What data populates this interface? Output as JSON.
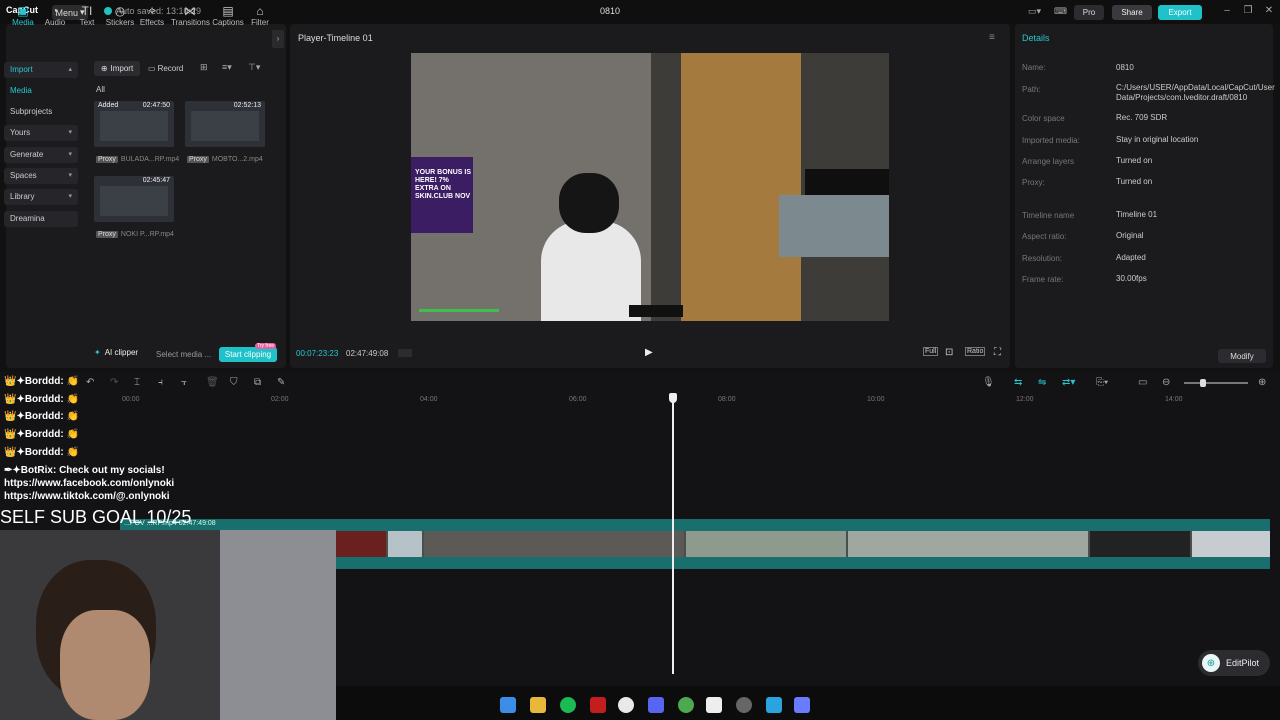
{
  "topbar": {
    "logo": "CapCut",
    "menu_label": "Menu",
    "autosave": "Auto saved: 13:10:29",
    "doc_title": "0810",
    "pro_label": "Pro",
    "share_label": "Share",
    "export_label": "Export"
  },
  "tooltabs": [
    "Media",
    "Audio",
    "Text",
    "Stickers",
    "Effects",
    "Transitions",
    "Captions",
    "Filter"
  ],
  "sidenav": {
    "import": "Import",
    "media": "Media",
    "subprojects": "Subprojects",
    "yours": "Yours",
    "generate": "Generate",
    "spaces": "Spaces",
    "library": "Library",
    "dreamina": "Dreamina"
  },
  "media": {
    "import_label": "Import",
    "record_label": "Record",
    "all_label": "All",
    "items": [
      {
        "badge": "Added",
        "duration": "02:47:50",
        "proxy": "Proxy",
        "name": "BULADA...RP.mp4"
      },
      {
        "badge": "",
        "duration": "02:52:13",
        "proxy": "Proxy",
        "name": "MOBTO...2.mp4"
      },
      {
        "badge": "",
        "duration": "02:45:47",
        "proxy": "Proxy",
        "name": "NOKI P...RP.mp4"
      }
    ],
    "ai_clipper": "AI clipper",
    "select_media": "Select media ...",
    "start_clipping": "Start clipping",
    "try_free": "Try free"
  },
  "player": {
    "title": "Player-Timeline 01",
    "promo_text": "YOUR BONUS IS HERE! 7% EXTRA ON SKIN.CLUB NOV",
    "current_time": "00:07:23:23",
    "total_time": "02:47:49:08",
    "full_label": "Full",
    "ratio_label": "Ratio"
  },
  "details": {
    "title": "Details",
    "rows": [
      {
        "label": "Name:",
        "value": "0810"
      },
      {
        "label": "Path:",
        "value": "C:/Users/USER/AppData/Local/CapCut/User Data/Projects/com.lveditor.draft/0810"
      },
      {
        "label": "Color space",
        "value": "Rec. 709 SDR"
      },
      {
        "label": "Imported media:",
        "value": "Stay in original location"
      },
      {
        "label": "Arrange layers",
        "value": "Turned on"
      },
      {
        "label": "Proxy:",
        "value": "Turned on"
      },
      {
        "label": "Timeline name",
        "value": "Timeline 01"
      },
      {
        "label": "Aspect ratio:",
        "value": "Original"
      },
      {
        "label": "Resolution:",
        "value": "Adapted"
      },
      {
        "label": "Frame rate:",
        "value": "30.00fps"
      }
    ],
    "modify_label": "Modify"
  },
  "timeline": {
    "ruler_ticks": [
      "00:00",
      "02:00",
      "04:00",
      "06:00",
      "08:00",
      "10:00",
      "12:00",
      "14:00"
    ],
    "track_label": "...POV ...RP.mp4  02:47:49:08",
    "editpilot_label": "EditPilot"
  },
  "overlay": {
    "chat": [
      {
        "text": "👑✦Borddd: 👏"
      },
      {
        "text": "👑✦Borddd: 👏"
      },
      {
        "text": "👑✦Borddd: 👏"
      },
      {
        "text": "👑✦Borddd: 👏"
      },
      {
        "text": "👑✦Borddd: 👏"
      },
      {
        "text": "✒✦BotRix: Check out my socials!"
      },
      {
        "text": "https://www.facebook.com/onlynoki"
      },
      {
        "text": "https://www.tiktok.com/@.onlynoki"
      }
    ],
    "sub_goal": "SELF SUB GOAL 10/25"
  },
  "colors": {
    "accent": "#1ec2c8",
    "panel": "#1b1b1d",
    "track": "#186f6e"
  }
}
